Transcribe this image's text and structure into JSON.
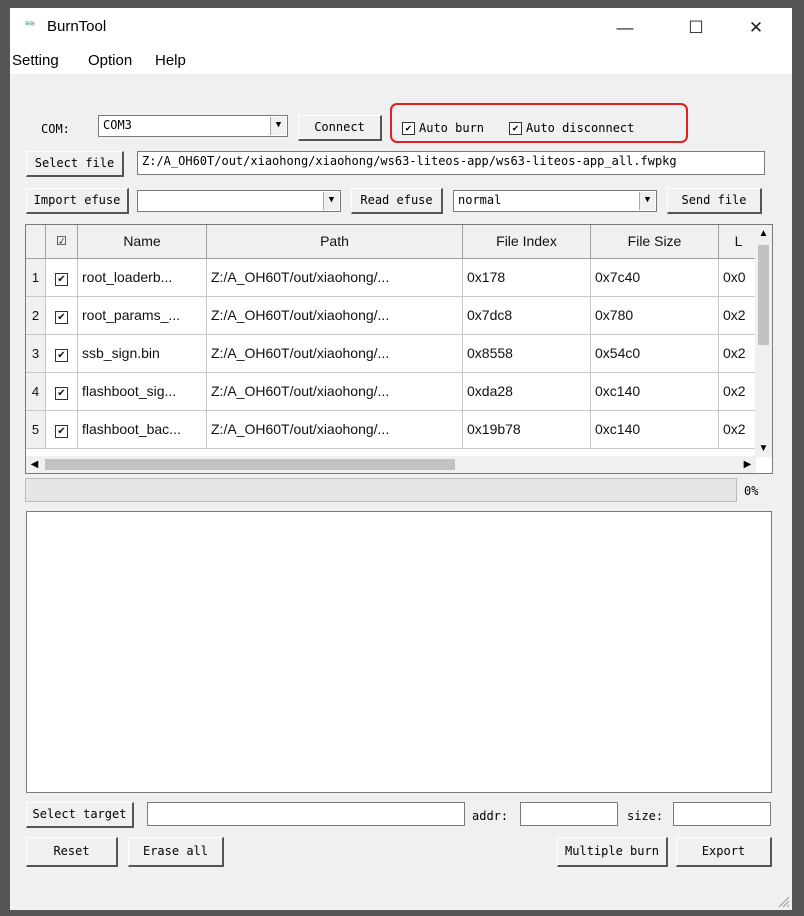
{
  "window": {
    "title": "BurnTool",
    "minimize": "—",
    "maximize": "☐",
    "close": "✕",
    "app_icon_glyph": "≋≋"
  },
  "menu": [
    "Setting",
    "Option",
    "Help"
  ],
  "com": {
    "label": "COM:",
    "value": "COM3"
  },
  "connect_label": "Connect",
  "auto_burn": {
    "label": "Auto burn",
    "checked": true
  },
  "auto_disconnect": {
    "label": "Auto disconnect",
    "checked": true
  },
  "select_file": {
    "label": "Select file",
    "path": "Z:/A_OH60T/out/xiaohong/xiaohong/ws63-liteos-app/ws63-liteos-app_all.fwpkg"
  },
  "import_efuse": {
    "label": "Import efuse",
    "value": ""
  },
  "read_efuse_label": "Read efuse",
  "mode": {
    "value": "normal"
  },
  "send_file_label": "Send file",
  "table": {
    "headers": [
      "☑",
      "Name",
      "Path",
      "File Index",
      "File Size",
      "L"
    ],
    "rows": [
      {
        "num": "1",
        "name": "root_loaderb...",
        "path": "Z:/A_OH60T/out/xiaohong/...",
        "index": "0x178",
        "size": "0x7c40",
        "extra": "0x0"
      },
      {
        "num": "2",
        "name": "root_params_...",
        "path": "Z:/A_OH60T/out/xiaohong/...",
        "index": "0x7dc8",
        "size": "0x780",
        "extra": "0x2"
      },
      {
        "num": "3",
        "name": "ssb_sign.bin",
        "path": "Z:/A_OH60T/out/xiaohong/...",
        "index": "0x8558",
        "size": "0x54c0",
        "extra": "0x2"
      },
      {
        "num": "4",
        "name": "flashboot_sig...",
        "path": "Z:/A_OH60T/out/xiaohong/...",
        "index": "0xda28",
        "size": "0xc140",
        "extra": "0x2"
      },
      {
        "num": "5",
        "name": "flashboot_bac...",
        "path": "Z:/A_OH60T/out/xiaohong/...",
        "index": "0x19b78",
        "size": "0xc140",
        "extra": "0x2"
      }
    ]
  },
  "progress": {
    "percent_text": "0%",
    "value": 0
  },
  "select_target": {
    "label": "Select target",
    "value": ""
  },
  "addr": {
    "label": "addr:",
    "value": ""
  },
  "size": {
    "label": "size:",
    "value": ""
  },
  "buttons": {
    "reset": "Reset",
    "erase_all": "Erase all",
    "multiple_burn": "Multiple burn",
    "export": "Export"
  },
  "colors": {
    "highlight": "#e02020",
    "window_bg": "#f0f0f0"
  }
}
